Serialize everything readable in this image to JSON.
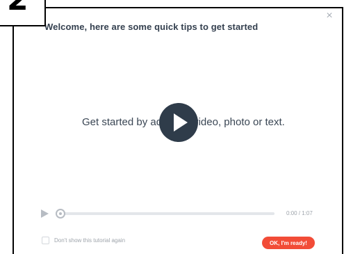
{
  "step_badge": "2",
  "modal": {
    "title": "Welcome, here are some quick tips to get started",
    "close_icon": "×"
  },
  "video": {
    "caption": "Get started by adding a video, photo or text.",
    "play_icon": "play-icon",
    "time": "0:00 / 1:07",
    "progress_fraction": 0.0
  },
  "footer": {
    "checkbox_label": "Don't show this tutorial again",
    "checkbox_checked": false,
    "ready_button": "OK, I'm ready!"
  },
  "colors": {
    "accent": "#f24c37",
    "text_dark": "#34404f",
    "play_overlay": "#2f3c4a",
    "muted": "#9ea4ab"
  }
}
